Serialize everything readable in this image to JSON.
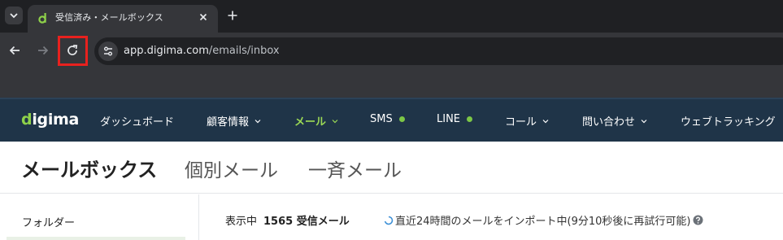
{
  "browser": {
    "tab": {
      "title": "受信済み・メールボックス"
    },
    "address": {
      "domain": "app.digima.com",
      "path": "/emails/inbox"
    }
  },
  "app": {
    "logo": {
      "first": "d",
      "rest": "igima"
    },
    "nav": [
      {
        "label": "ダッシュボード"
      },
      {
        "label": "顧客情報"
      },
      {
        "label": "メール"
      },
      {
        "label": "SMS"
      },
      {
        "label": "LINE"
      },
      {
        "label": "コール"
      },
      {
        "label": "問い合わせ"
      },
      {
        "label": "ウェブトラッキング"
      }
    ],
    "colors": {
      "nav_bg": "#1f3448",
      "accent": "#9bd955",
      "status_dot": "#7cc746",
      "highlight": "#e8211e"
    }
  },
  "page": {
    "title": "メールボックス",
    "tabs": [
      {
        "label": "個別メール"
      },
      {
        "label": "一斉メール"
      }
    ]
  },
  "sidebar": {
    "folder_label": "フォルダー"
  },
  "main": {
    "showing_label": "表示中",
    "count": "1565 受信メール",
    "import_status": "直近24時間のメールをインポート中(9分10秒後に再試行可能)"
  }
}
